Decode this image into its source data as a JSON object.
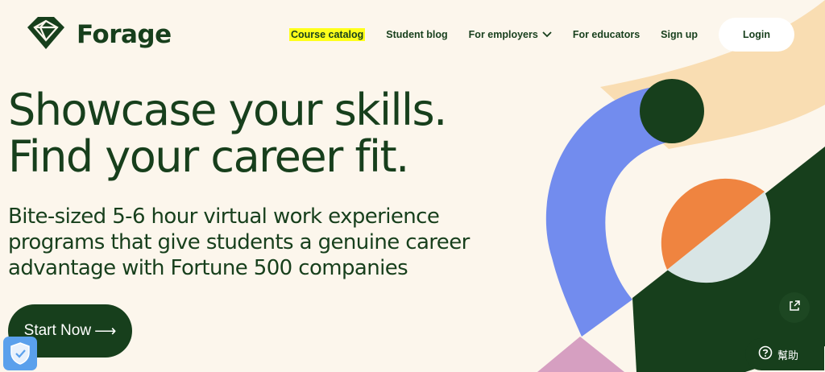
{
  "brand": {
    "name": "Forage",
    "logo_icon": "forage-diamond-logo"
  },
  "nav": {
    "course_catalog": "Course catalog",
    "student_blog": "Student blog",
    "for_employers": "For employers",
    "for_educators": "For educators",
    "sign_up": "Sign up",
    "login": "Login"
  },
  "hero": {
    "title_line1": "Showcase your skills.",
    "title_line2": "Find your career fit.",
    "subtitle_line1": "Bite-sized 5-6 hour virtual work experience",
    "subtitle_line2": "programs that give students a genuine career",
    "subtitle_line3": "advantage with Fortune 500 companies",
    "cta_label": "Start Now",
    "cta_arrow": "⟶"
  },
  "widgets": {
    "help_label": "幫助",
    "help_icon": "question-circle-icon",
    "share_icon": "share-icon",
    "shield_icon": "shield-check-icon"
  },
  "colors": {
    "background": "#fcf6ec",
    "brand_green": "#173f1c",
    "highlight": "#ffff1a",
    "blue": "#728cee",
    "orange": "#ef8440",
    "light_blue": "#d8e5e5",
    "peach": "#f9ddb2",
    "pink": "#d69fc1"
  }
}
